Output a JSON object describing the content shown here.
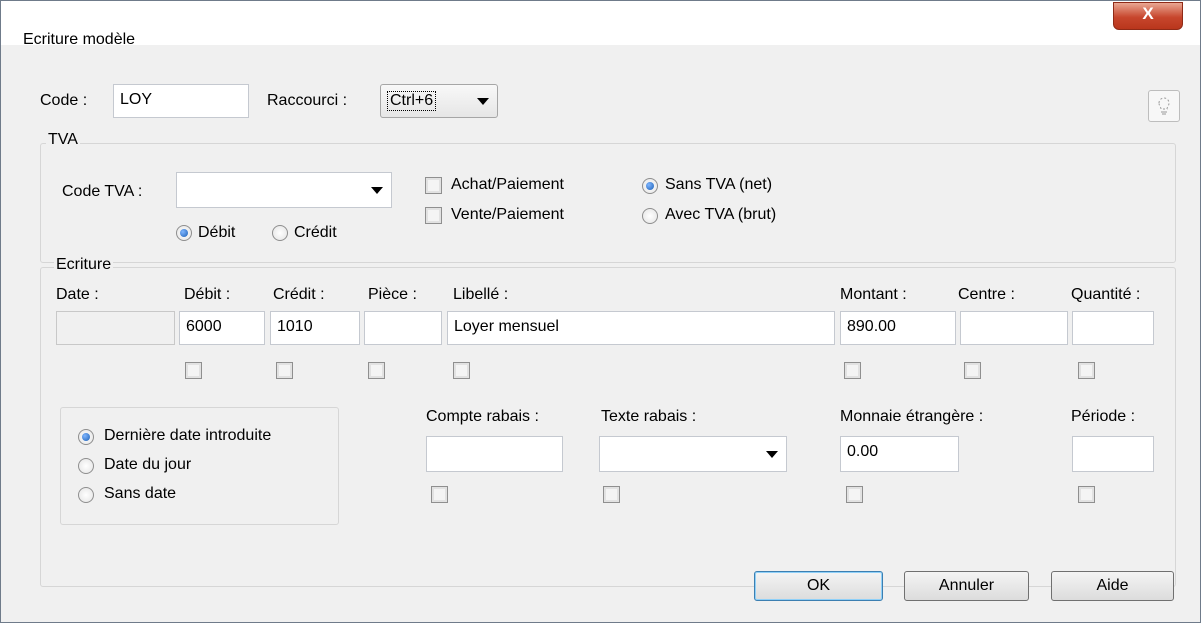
{
  "window": {
    "title": "Ecriture modèle",
    "close_glyph": "X"
  },
  "header": {
    "code_label": "Code :",
    "code_value": "LOY",
    "raccourci_label": "Raccourci :",
    "raccourci_value": "Ctrl+6"
  },
  "tva": {
    "legend": "TVA",
    "code_tva_label": "Code TVA :",
    "code_tva_value": "",
    "debit_label": "Débit",
    "credit_label": "Crédit",
    "selected_side": "Débit",
    "achat_label": "Achat/Paiement",
    "vente_label": "Vente/Paiement",
    "sans_tva_label": "Sans TVA (net)",
    "avec_tva_label": "Avec TVA (brut)",
    "selected_mode": "Sans TVA (net)"
  },
  "ecriture": {
    "legend": "Ecriture",
    "columns": {
      "date": "Date :",
      "debit": "Débit :",
      "credit": "Crédit :",
      "piece": "Pièce :",
      "libelle": "Libellé :",
      "montant": "Montant :",
      "centre": "Centre :",
      "quantite": "Quantité :"
    },
    "values": {
      "date": "",
      "debit": "6000",
      "credit": "1010",
      "piece": "",
      "libelle": "Loyer mensuel",
      "montant": "890.00",
      "centre": "",
      "quantite": ""
    },
    "date_options": {
      "derniere": "Dernière date introduite",
      "jour": "Date du jour",
      "sans": "Sans date",
      "selected": "Dernière date introduite"
    },
    "compte_rabais_label": "Compte rabais :",
    "compte_rabais_value": "",
    "texte_rabais_label": "Texte rabais :",
    "texte_rabais_value": "",
    "monnaie_label": "Monnaie étrangère :",
    "monnaie_value": "0.00",
    "periode_label": "Période :",
    "periode_value": ""
  },
  "buttons": {
    "ok": "OK",
    "annuler": "Annuler",
    "aide": "Aide"
  },
  "icons": {
    "close": "close-icon",
    "lightbulb": "lightbulb-icon",
    "dropdown": "chevron-down-icon"
  }
}
